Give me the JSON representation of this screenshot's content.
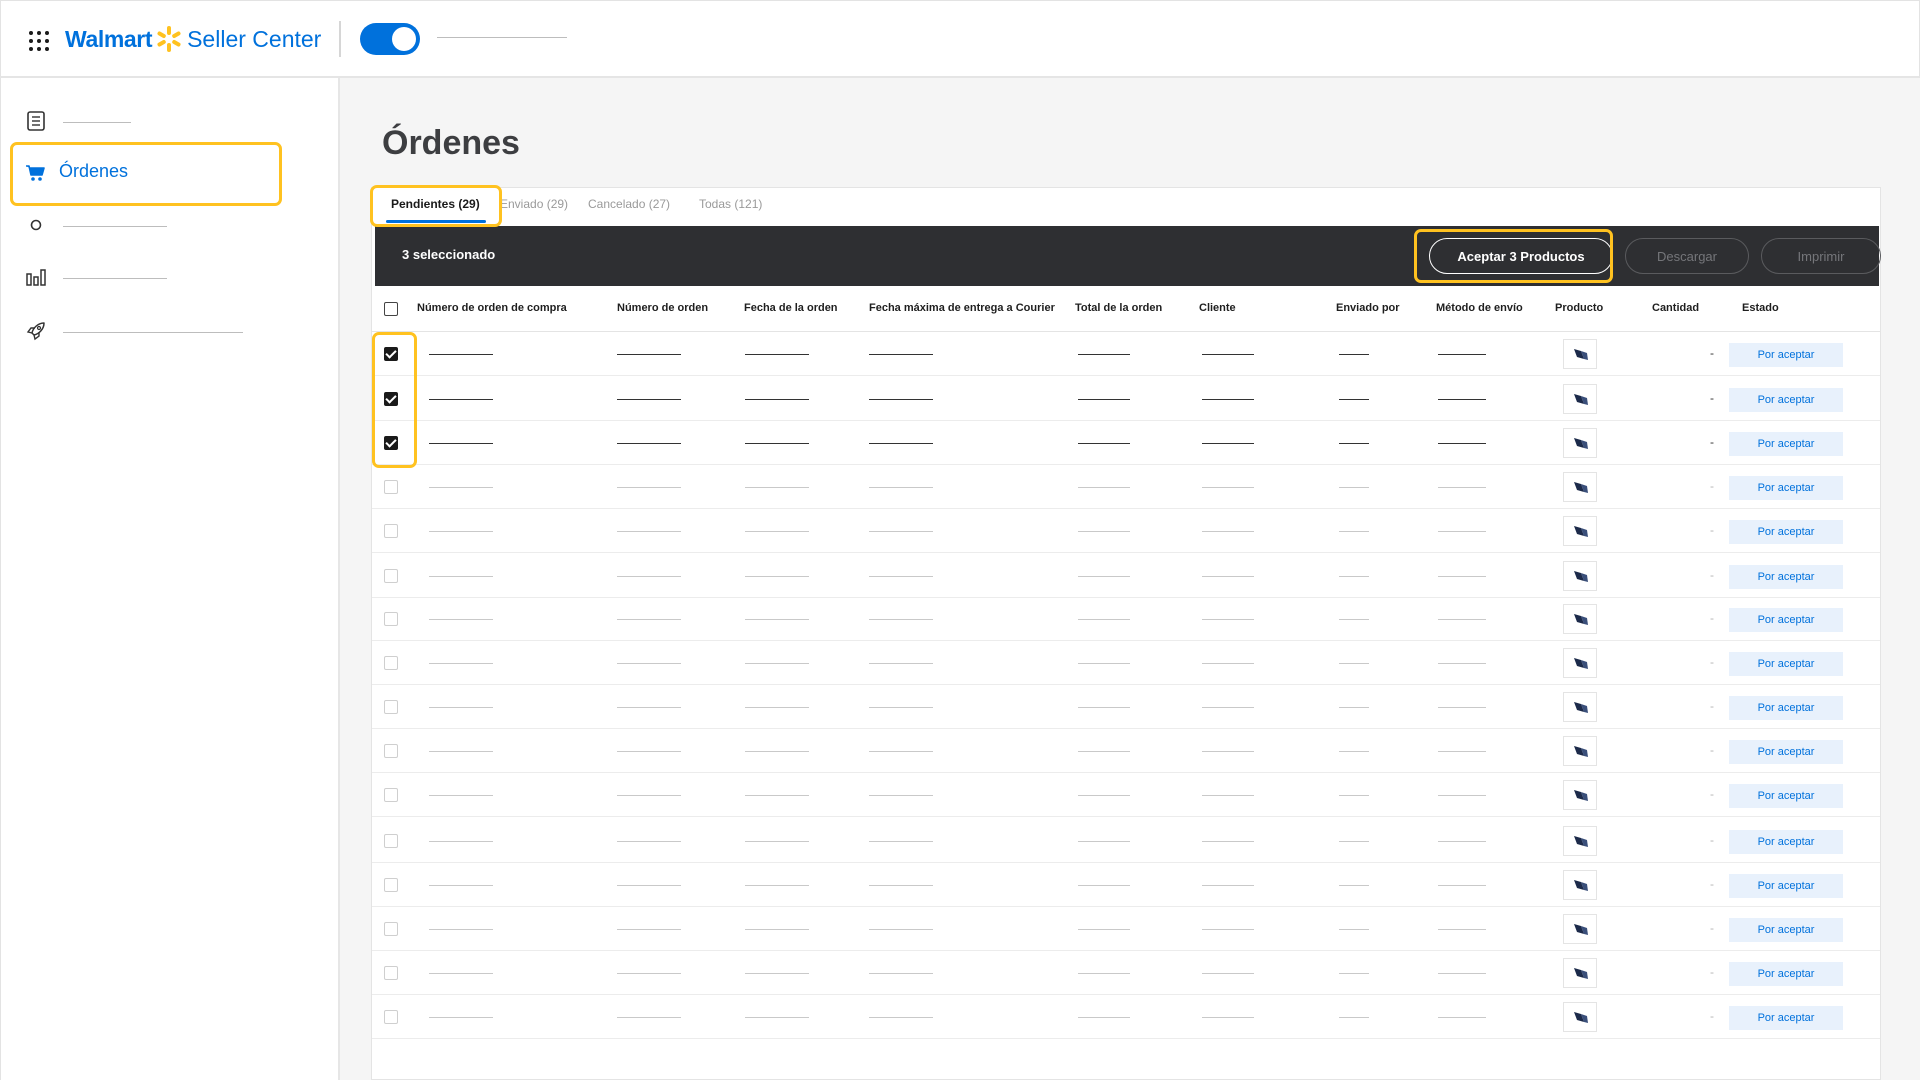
{
  "header": {
    "brand_walmart": "Walmart",
    "brand_seller": "Seller Center",
    "icons": {
      "apps": "apps-grid-icon",
      "spark": "walmart-spark-icon"
    },
    "toggle_on": true
  },
  "sidebar": {
    "items": [
      {
        "icon": "document-list-icon",
        "label": ""
      },
      {
        "icon": "cart-icon",
        "label": "Órdenes",
        "active": true
      },
      {
        "icon": "circle-icon",
        "label": ""
      },
      {
        "icon": "bar-chart-icon",
        "label": ""
      },
      {
        "icon": "rocket-icon",
        "label": ""
      }
    ]
  },
  "page": {
    "title": "Órdenes"
  },
  "tabs": [
    {
      "label": "Pendientes (29)",
      "active": true
    },
    {
      "label": "Enviado (29)"
    },
    {
      "label": "Cancelado (27)"
    },
    {
      "label": "Todas (121)"
    }
  ],
  "toolbar": {
    "selected_text": "3 seleccionado",
    "accept_label": "Aceptar 3 Productos",
    "download_label": "Descargar",
    "print_label": "Imprimir"
  },
  "table": {
    "columns": [
      "Número de orden de compra",
      "Número de orden",
      "Fecha de la orden",
      "Fecha máxima de entrega a Courier",
      "Total de la orden",
      "Cliente",
      "Enviado por",
      "Método de envío",
      "Producto",
      "Cantidad",
      "Estado"
    ],
    "quantity_placeholder": "-",
    "status_label": "Por aceptar",
    "total_rows": 16,
    "checked_rows": 3
  },
  "colors": {
    "brand_blue": "#0071dc",
    "spark_yellow": "#ffc220",
    "toolbar_dark": "#2e2f32",
    "status_bg": "#e8f1fc",
    "highlight": "#ffc220"
  }
}
